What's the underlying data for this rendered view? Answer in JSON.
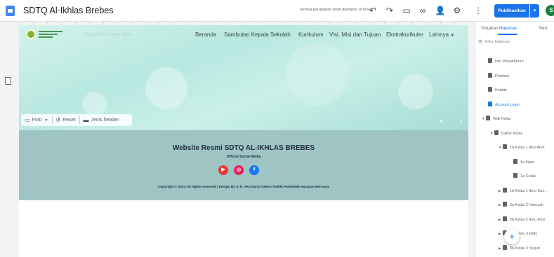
{
  "app": {
    "doc_title": "SDTQ Al-Ikhlas Brebes",
    "save_status": "Semua perubahan telah disimpan di Drive",
    "publish_label": "Publikasikan",
    "avatar_initial": "S",
    "icons": [
      "undo-icon",
      "redo-icon",
      "preview-icon",
      "link-icon",
      "share-icon",
      "settings-icon",
      "more-vert-icon"
    ]
  },
  "site": {
    "title_placeholder": "Masukkan nama situs",
    "nav": [
      "Beranda",
      "Sambutan Kepala Sekolah",
      "Kurikulum",
      "Visi, Misi dan Tujuan",
      "Ekstrakurikuler",
      "Lainnya"
    ],
    "header_tools": {
      "image": "Foto",
      "reset": "Reset",
      "header_type": "Jenis header"
    },
    "footer": {
      "title": "Website Resmi SDTQ AL-IKHLAS BREBES",
      "subtitle": "Official Social Media",
      "socials": [
        "youtube-icon",
        "instagram-icon",
        "facebook-icon"
      ],
      "copyright": "Copyright © 2024 All rights reserved | Design By S.Tr. Akuntansi Sektor Publik-Politeknik Harapan Bersama"
    }
  },
  "panel": {
    "tabs": [
      "Sisipkan",
      "Halaman",
      "Tem"
    ],
    "active_tab": "Halaman",
    "filter_placeholder": "Filter halaman",
    "pages": [
      {
        "label": "Info Pendaftaran",
        "level": 0,
        "caret": ""
      },
      {
        "label": "Prestasi",
        "level": 0,
        "caret": ""
      },
      {
        "label": "Kontak",
        "level": 0,
        "caret": ""
      },
      {
        "label": "Account Login",
        "level": 0,
        "caret": "",
        "active": true
      },
      {
        "label": "Wali Kelas",
        "level": 0,
        "caret": "▼"
      },
      {
        "label": "Daftar Kelas",
        "level": 1,
        "caret": "▼"
      },
      {
        "label": "1a Kelas 1 Abu Amri",
        "level": 2,
        "caret": "▼"
      },
      {
        "label": "1a Input",
        "level": 3,
        "caret": ""
      },
      {
        "label": "1a Cetak",
        "level": 3,
        "caret": ""
      },
      {
        "label": "1b Kelas 1 Ibnu Kat...",
        "level": 2,
        "caret": "▶"
      },
      {
        "label": "2a Kelas 2 Hamzah",
        "level": 2,
        "caret": "▶"
      },
      {
        "label": "2b Kelas 2 Ibnu Amir",
        "level": 2,
        "caret": "▶"
      },
      {
        "label": "3a Kelas 3 Hafs",
        "level": 2,
        "caret": "▶"
      },
      {
        "label": "3b Kelas 3 Yaqub",
        "level": 2,
        "caret": "▶"
      }
    ],
    "colors": {
      "accent": "#1a73e8"
    }
  }
}
